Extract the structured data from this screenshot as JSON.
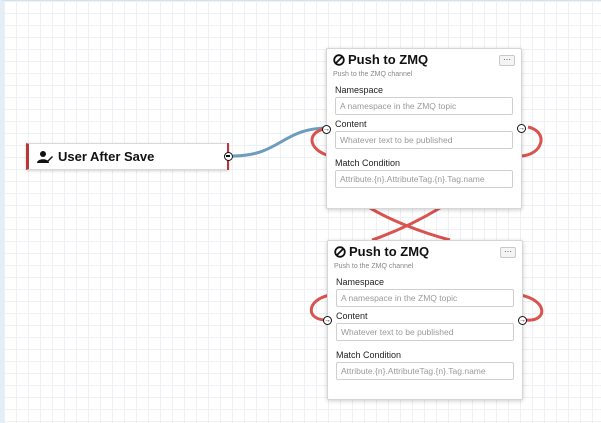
{
  "trigger": {
    "title": "User After Save",
    "icon": "user-edit-icon"
  },
  "actions": [
    {
      "title": "Push to ZMQ",
      "icon": "ban-icon",
      "menu_label": "···",
      "subtitle": "Push to the ZMQ channel",
      "fields": [
        {
          "label": "Namespace",
          "placeholder": "A namespace in the ZMQ topic"
        },
        {
          "label": "Content",
          "placeholder": "Whatever text to be published"
        },
        {
          "label": "Match Condition",
          "placeholder": "Attribute.{n}.AttributeTag.{n}.Tag.name"
        }
      ]
    },
    {
      "title": "Push to ZMQ",
      "icon": "ban-icon",
      "menu_label": "···",
      "subtitle": "Push to the ZMQ channel",
      "fields": [
        {
          "label": "Namespace",
          "placeholder": "A namespace in the ZMQ topic"
        },
        {
          "label": "Content",
          "placeholder": "Whatever text to be published"
        },
        {
          "label": "Match Condition",
          "placeholder": "Attribute.{n}.AttributeTag.{n}.Tag.name"
        }
      ]
    }
  ],
  "colors": {
    "trigger_connection": "#6f9bbd",
    "action_connection": "#d9534f",
    "trigger_accent": "#b8363c"
  }
}
